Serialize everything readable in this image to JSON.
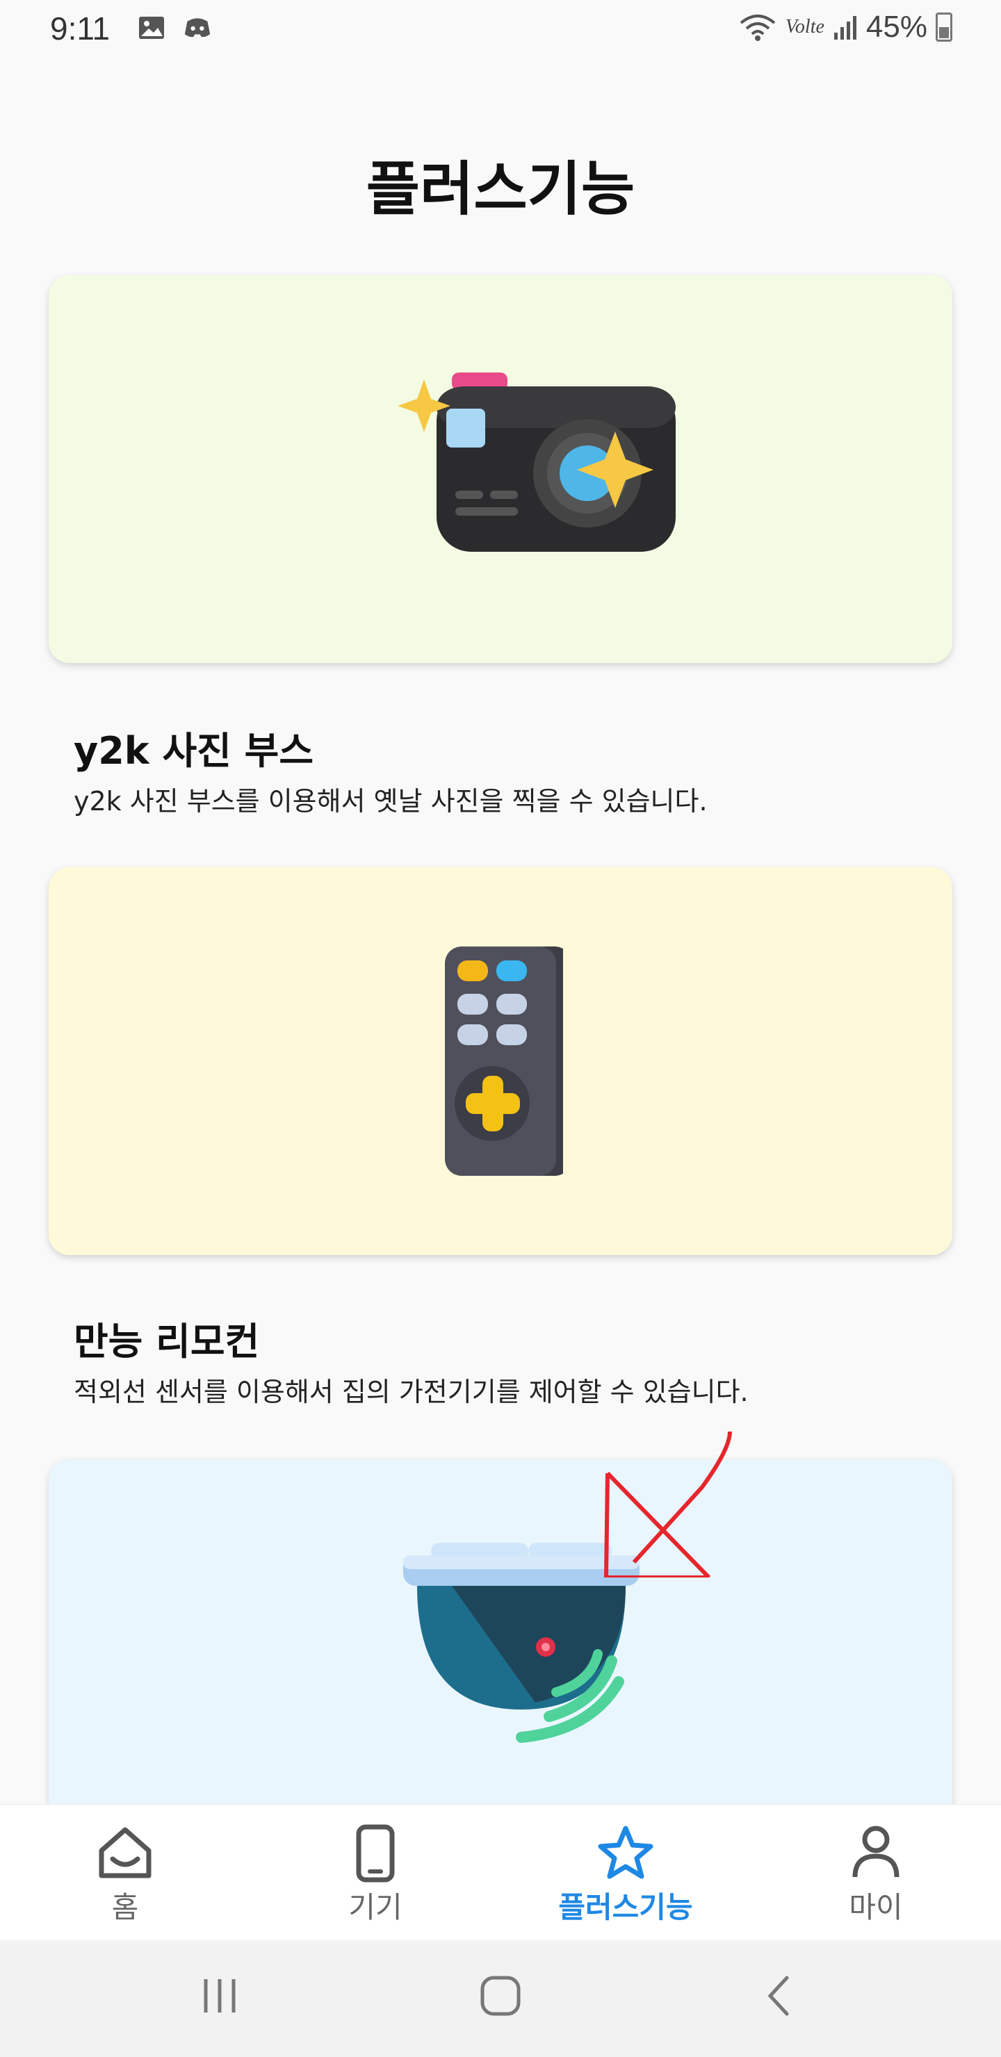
{
  "status_bar": {
    "time": "9:11",
    "battery": "45%",
    "network": "Volte"
  },
  "page": {
    "title": "플러스기능"
  },
  "cards": [
    {
      "icon": "camera-icon",
      "bg": "#f3fce3",
      "title": "y2k 사진 부스",
      "description": "y2k 사진 부스를 이용해서 옛날 사진을 찍을 수 있습니다."
    },
    {
      "icon": "remote-control-icon",
      "bg": "#fefad9",
      "title": "만능 리모컨",
      "description": "적외선 센서를 이용해서 집의 가전기기를 제어할 수 있습니다."
    },
    {
      "icon": "security-camera-icon",
      "bg": "#eaf6fe",
      "title": "",
      "description": ""
    }
  ],
  "bottom_nav": {
    "items": [
      {
        "label": "홈",
        "icon": "home-icon",
        "active": false
      },
      {
        "label": "기기",
        "icon": "phone-icon",
        "active": false
      },
      {
        "label": "플러스기능",
        "icon": "star-icon",
        "active": true
      },
      {
        "label": "마이",
        "icon": "person-icon",
        "active": false
      }
    ],
    "active_color": "#1e88e5"
  }
}
